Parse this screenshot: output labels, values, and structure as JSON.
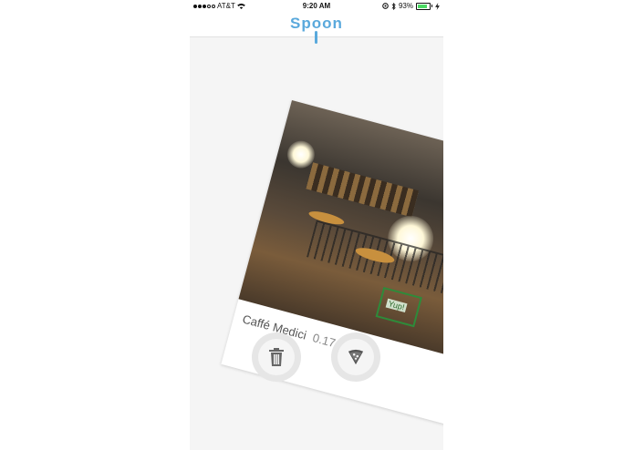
{
  "status_bar": {
    "carrier": "AT&T",
    "time": "9:20 AM",
    "battery": "93%",
    "battery_level": 0.93
  },
  "header": {
    "logo": "Spoon"
  },
  "card": {
    "place_name": "Caffé Medici",
    "distance": "0.17 mi",
    "label": "Yup!"
  },
  "actions": {
    "delete_icon": "trash-icon",
    "pizza_icon": "pizza-icon"
  },
  "colors": {
    "brand": "#5aa9dc",
    "battery": "#4cd964",
    "yup_box": "#2e8b3a"
  }
}
